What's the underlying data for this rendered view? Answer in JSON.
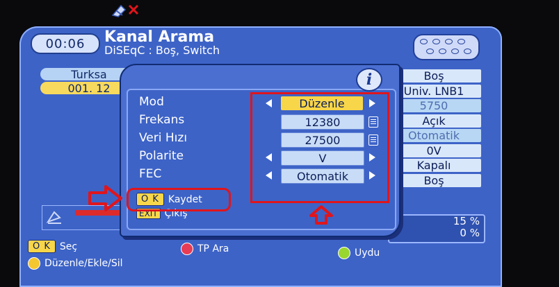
{
  "header": {
    "time": "00:06",
    "title": "Kanal Arama",
    "subtitle": "DiSEqC : Boş, Switch"
  },
  "left_list": {
    "satellite": "Turksa",
    "channel": "001. 12"
  },
  "right_col": {
    "values": [
      "Boş",
      "Univ. LNB1",
      "5750",
      "Açık",
      "Otomatik",
      "0V",
      "Kapalı",
      "Boş"
    ]
  },
  "dialog": {
    "info_symbol": "i",
    "fields": [
      {
        "label": "Mod",
        "value": "Düzenle",
        "control": "arrows"
      },
      {
        "label": "Frekans",
        "value": "12380",
        "control": "keypad"
      },
      {
        "label": "Veri Hızı",
        "value": "27500",
        "control": "keypad"
      },
      {
        "label": "Polarite",
        "value": "V",
        "control": "arrows"
      },
      {
        "label": "FEC",
        "value": "Otomatik",
        "control": "arrows"
      }
    ],
    "ok_key": "O K",
    "ok_label": "Kaydet",
    "exit_key": "EXIT",
    "exit_label": "Çıkış"
  },
  "status": {
    "signal_pct": "15 %",
    "quality_pct": "0 %"
  },
  "footer": {
    "ok_key": "O K",
    "ok_label": "Seç",
    "red_label": "TP Ara",
    "green_label": "Uydu",
    "yellow_label": "Düzenle/Ekle/Sil"
  },
  "colors": {
    "selection": "#f8d649",
    "annotation_red": "#e0151c",
    "panel_blue": "#3d63c7"
  }
}
